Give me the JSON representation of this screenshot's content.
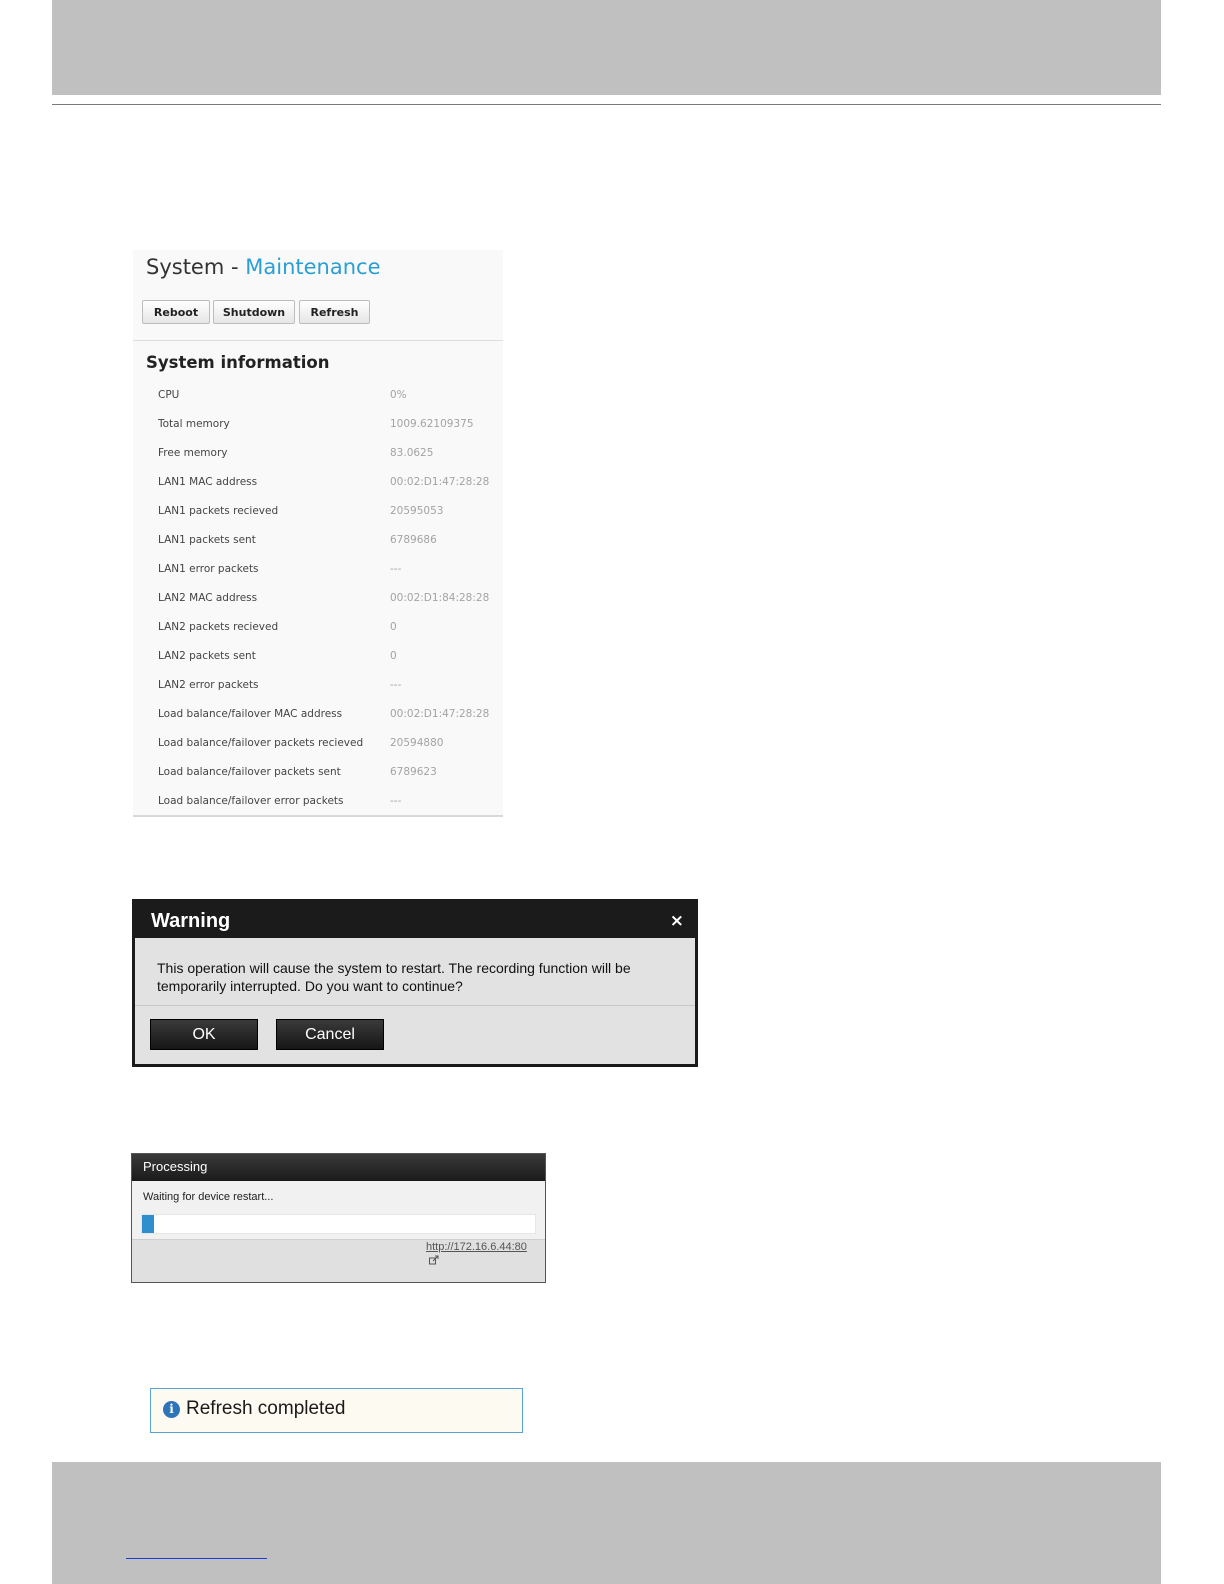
{
  "maintenance": {
    "title_prefix": "System - ",
    "title_accent": "Maintenance",
    "buttons": {
      "reboot": "Reboot",
      "shutdown": "Shutdown",
      "refresh": "Refresh"
    },
    "section_heading": "System information",
    "rows": [
      {
        "label": "CPU",
        "value": "0%"
      },
      {
        "label": "Total memory",
        "value": "1009.62109375"
      },
      {
        "label": "Free memory",
        "value": "83.0625"
      },
      {
        "label": "LAN1 MAC address",
        "value": "00:02:D1:47:28:28"
      },
      {
        "label": "LAN1 packets recieved",
        "value": "20595053"
      },
      {
        "label": "LAN1 packets sent",
        "value": "6789686"
      },
      {
        "label": "LAN1 error packets",
        "value": "---"
      },
      {
        "label": "LAN2 MAC address",
        "value": "00:02:D1:84:28:28"
      },
      {
        "label": "LAN2 packets recieved",
        "value": "0"
      },
      {
        "label": "LAN2 packets sent",
        "value": "0"
      },
      {
        "label": "LAN2 error packets",
        "value": "---"
      },
      {
        "label": "Load balance/failover MAC address",
        "value": "00:02:D1:47:28:28"
      },
      {
        "label": "Load balance/failover packets recieved",
        "value": "20594880"
      },
      {
        "label": "Load balance/failover packets sent",
        "value": "6789623"
      },
      {
        "label": "Load balance/failover error packets",
        "value": "---"
      }
    ]
  },
  "warning_dialog": {
    "title": "Warning",
    "close_glyph": "×",
    "message": "This operation will cause the system to restart. The recording function will be temporarily interrupted. Do you want to continue?",
    "ok_label": "OK",
    "cancel_label": "Cancel"
  },
  "processing_dialog": {
    "title": "Processing",
    "message": "Waiting for device restart...",
    "progress_percent": 3,
    "progress_color": "#2f8fce",
    "link_text": "http://172.16.6.44:80",
    "link_icon": "external-link-icon"
  },
  "notice": {
    "icon": "info-icon",
    "icon_glyph": "i",
    "text": "Refresh completed"
  }
}
